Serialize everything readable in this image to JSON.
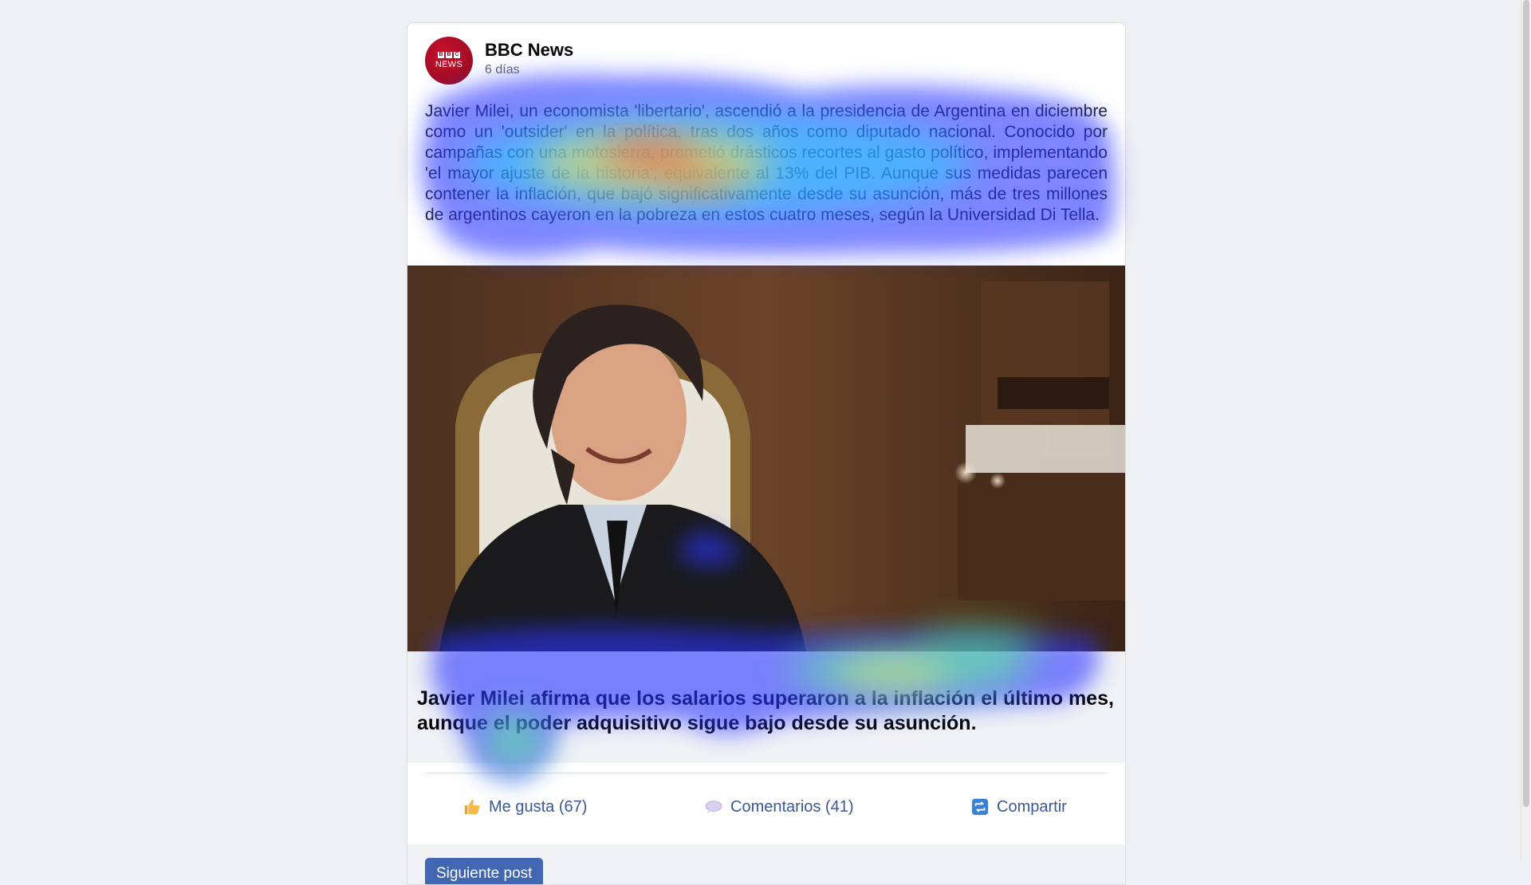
{
  "post": {
    "author": "BBC News",
    "time": "6 días",
    "avatar_text_top": "BBC",
    "avatar_text_bottom": "NEWS",
    "body": "Javier Milei, un economista 'libertario', ascendió a la presidencia de Argentina en diciembre como un 'outsider' en la política, tras dos años como diputado nacional. Conocido por campañas con una motosierra, prometió drásticos recortes al gasto político, implementando 'el mayor ajuste de la historia', equivalente al 13% del PIB. Aunque sus medidas parecen contener la inflación, que bajó significativamente desde su asunción, más de tres millones de argentinos cayeron en la pobreza en estos cuatro meses, según la Universidad Di Tella.",
    "link_headline": "Javier Milei afirma que los salarios superaron a la inflación el último mes, aunque el poder adquisitivo sigue bajo desde su asunción."
  },
  "actions": {
    "like_label": "Me gusta (67)",
    "comment_label": "Comentarios (41)",
    "share_label": "Compartir"
  },
  "footer": {
    "next_label": "Siguiente post"
  },
  "colors": {
    "link_blue": "#385898",
    "button_blue": "#4267b2",
    "brand_red": "#b80000"
  },
  "icons": {
    "like": "thumbs-up-icon",
    "comment": "speech-bubble-icon",
    "share": "share-arrows-icon"
  }
}
